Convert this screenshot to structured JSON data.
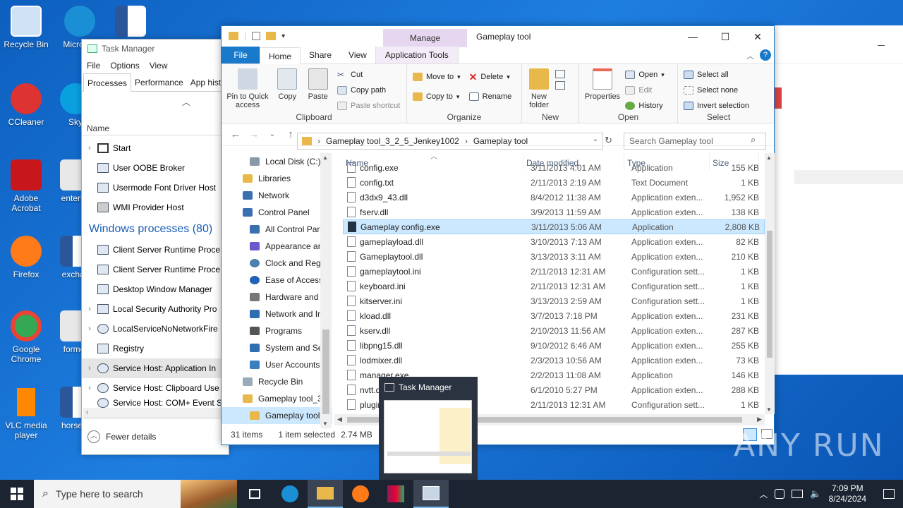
{
  "desktop_icons": [
    {
      "label": "Recycle Bin",
      "color": "#cfe3f5"
    },
    {
      "label": "Micro Ed",
      "color": "#1a8fd6"
    },
    {
      "label": "",
      "color": "#2b579a"
    },
    {
      "label": "CCleaner",
      "color": "#d33"
    },
    {
      "label": "Sky",
      "color": "#0aa0e0"
    },
    {
      "label": "Adobe Acrobat",
      "color": "#c8171c"
    },
    {
      "label": "enterbe",
      "color": "#e8e8e8"
    },
    {
      "label": "Firefox",
      "color": "#ff7a19"
    },
    {
      "label": "exchan",
      "color": "#2b579a"
    },
    {
      "label": "Google Chrome",
      "color": "#34a853"
    },
    {
      "label": "former",
      "color": "#e8e8e8"
    },
    {
      "label": "VLC media player",
      "color": "#ff8800"
    },
    {
      "label": "horsem",
      "color": "#2b579a"
    }
  ],
  "task_manager": {
    "title": "Task Manager",
    "menu": [
      "File",
      "Options",
      "View"
    ],
    "tabs": [
      "Processes",
      "Performance",
      "App hist"
    ],
    "column_name": "Name",
    "apps": [
      "Start",
      "User OOBE Broker",
      "Usermode Font Driver Host",
      "WMI Provider Host"
    ],
    "group_label": "Windows processes (80)",
    "processes": [
      "Client Server Runtime Proce",
      "Client Server Runtime Proce",
      "Desktop Window Manager",
      "Local Security Authority Pro",
      "LocalServiceNoNetworkFire",
      "Registry",
      "Service Host: Application In",
      "Service Host: Clipboard Use",
      "Service Host: COM+ Event S"
    ],
    "fewer_details": "Fewer details"
  },
  "explorer": {
    "manage_tab": "Manage",
    "window_title": "Gameplay tool",
    "ribbon_tabs": {
      "file": "File",
      "home": "Home",
      "share": "Share",
      "view": "View",
      "app_tools": "Application Tools"
    },
    "clipboard": {
      "pin": "Pin to Quick access",
      "copy": "Copy",
      "paste": "Paste",
      "cut": "Cut",
      "copy_path": "Copy path",
      "paste_shortcut": "Paste shortcut",
      "label": "Clipboard"
    },
    "organize": {
      "move_to": "Move to",
      "copy_to": "Copy to",
      "delete": "Delete",
      "rename": "Rename",
      "label": "Organize"
    },
    "new": {
      "new_folder": "New folder",
      "label": "New"
    },
    "open": {
      "properties": "Properties",
      "open": "Open",
      "edit": "Edit",
      "history": "History",
      "label": "Open"
    },
    "select": {
      "select_all": "Select all",
      "select_none": "Select none",
      "invert": "Invert selection",
      "label": "Select"
    },
    "address": {
      "crumb1": "Gameplay tool_3_2_5_Jenkey1002",
      "crumb2": "Gameplay tool"
    },
    "search_placeholder": "Search Gameplay tool",
    "tree": [
      {
        "label": "Local Disk (C:)",
        "color": "#8899aa",
        "indent": 40
      },
      {
        "label": "Libraries",
        "color": "#e8b84a",
        "indent": 30
      },
      {
        "label": "Network",
        "color": "#3a6fb0",
        "indent": 30
      },
      {
        "label": "Control Panel",
        "color": "#3a6fb0",
        "indent": 30
      },
      {
        "label": "All Control Par",
        "color": "#3a6fb0",
        "indent": 40
      },
      {
        "label": "Appearance an",
        "color": "#6a5acd",
        "indent": 40
      },
      {
        "label": "Clock and Regi",
        "color": "#4a7fb0",
        "indent": 40
      },
      {
        "label": "Ease of Access",
        "color": "#1f63b5",
        "indent": 40
      },
      {
        "label": "Hardware and",
        "color": "#777",
        "indent": 40
      },
      {
        "label": "Network and Ir",
        "color": "#2f6fb0",
        "indent": 40
      },
      {
        "label": "Programs",
        "color": "#555",
        "indent": 40
      },
      {
        "label": "System and Se",
        "color": "#2f6fb0",
        "indent": 40
      },
      {
        "label": "User Accounts",
        "color": "#3a7fc0",
        "indent": 40
      },
      {
        "label": "Recycle Bin",
        "color": "#9ab",
        "indent": 30
      },
      {
        "label": "Gameplay tool_3",
        "color": "#e8b84a",
        "indent": 30
      },
      {
        "label": "Gameplay tool",
        "color": "#e8b84a",
        "indent": 40
      }
    ],
    "columns": [
      "Name",
      "Date modified",
      "Type",
      "Size"
    ],
    "files": [
      {
        "name": "config.exe",
        "date": "3/11/2013 4:01 AM",
        "type": "Application",
        "size": "155 KB"
      },
      {
        "name": "config.txt",
        "date": "2/11/2013 2:19 AM",
        "type": "Text Document",
        "size": "1 KB"
      },
      {
        "name": "d3dx9_43.dll",
        "date": "8/4/2012 11:38 AM",
        "type": "Application exten...",
        "size": "1,952 KB"
      },
      {
        "name": "fserv.dll",
        "date": "3/9/2013 11:59 AM",
        "type": "Application exten...",
        "size": "138 KB"
      },
      {
        "name": "Gameplay config.exe",
        "date": "3/11/2013 5:06 AM",
        "type": "Application",
        "size": "2,808 KB"
      },
      {
        "name": "gameplayload.dll",
        "date": "3/10/2013 7:13 AM",
        "type": "Application exten...",
        "size": "82 KB"
      },
      {
        "name": "Gameplaytool.dll",
        "date": "3/13/2013 3:11 AM",
        "type": "Application exten...",
        "size": "210 KB"
      },
      {
        "name": "gameplaytool.ini",
        "date": "2/11/2013 12:31 AM",
        "type": "Configuration sett...",
        "size": "1 KB"
      },
      {
        "name": "keyboard.ini",
        "date": "2/11/2013 12:31 AM",
        "type": "Configuration sett...",
        "size": "1 KB"
      },
      {
        "name": "kitserver.ini",
        "date": "3/13/2013 2:59 AM",
        "type": "Configuration sett...",
        "size": "1 KB"
      },
      {
        "name": "kload.dll",
        "date": "3/7/2013 7:18 PM",
        "type": "Application exten...",
        "size": "231 KB"
      },
      {
        "name": "kserv.dll",
        "date": "2/10/2013 11:56 AM",
        "type": "Application exten...",
        "size": "287 KB"
      },
      {
        "name": "libpng15.dll",
        "date": "9/10/2012 6:46 AM",
        "type": "Application exten...",
        "size": "255 KB"
      },
      {
        "name": "lodmixer.dll",
        "date": "2/3/2013 10:56 AM",
        "type": "Application exten...",
        "size": "73 KB"
      },
      {
        "name": "manager.exe",
        "date": "2/2/2013 11:08 AM",
        "type": "Application",
        "size": "146 KB"
      },
      {
        "name": "nvtt.dll",
        "date": "6/1/2010 5:27 PM",
        "type": "Application exten...",
        "size": "288 KB"
      },
      {
        "name": "plugin",
        "date": "2/11/2013 12:31 AM",
        "type": "Configuration sett...",
        "size": "1 KB"
      }
    ],
    "status": {
      "items": "31 items",
      "selected": "1 item selected",
      "size": "2.74 MB"
    }
  },
  "preview": {
    "title": "Task Manager"
  },
  "taskbar": {
    "search_placeholder": "Type here to search",
    "time": "7:09 PM",
    "date": "8/24/2024"
  },
  "watermark": "ANY RUN"
}
